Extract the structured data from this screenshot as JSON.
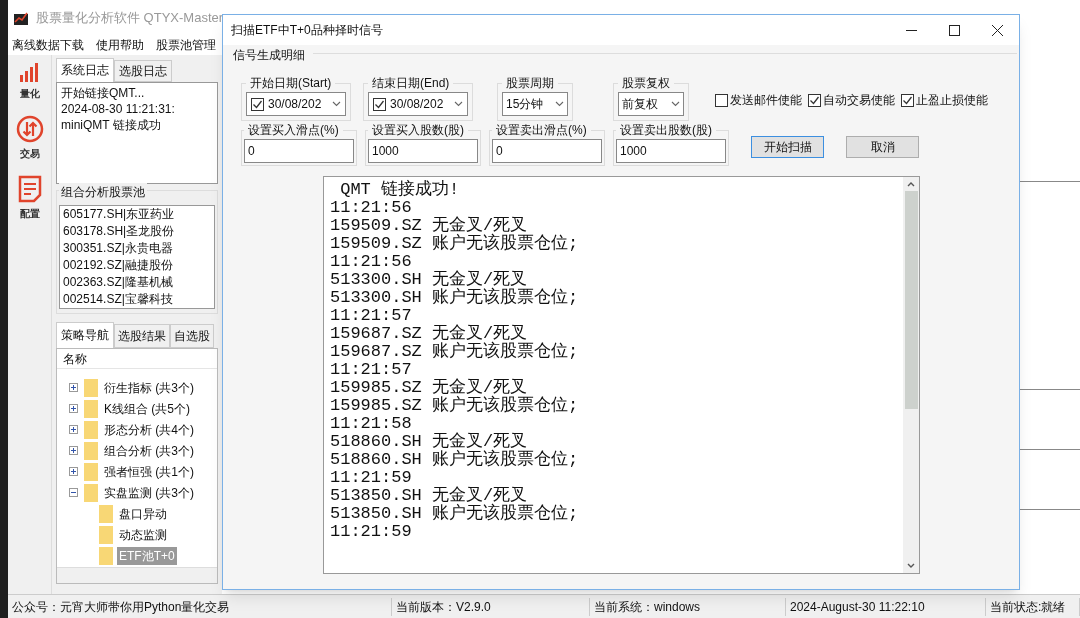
{
  "app": {
    "title": "股票量化分析软件 QTYX-Master",
    "menu": [
      "离线数据下载",
      "使用帮助",
      "股票池管理"
    ]
  },
  "sidebar": [
    {
      "label": "量化",
      "kind": "chart"
    },
    {
      "label": "交易",
      "kind": "trade"
    },
    {
      "label": "配置",
      "kind": "config"
    }
  ],
  "log_tabs": [
    {
      "label": "系统日志",
      "selected": true
    },
    {
      "label": "选股日志",
      "selected": false
    }
  ],
  "log_lines": [
    "开始链接QMT...",
    "2024-08-30 11:21:31:",
    "miniQMT 链接成功"
  ],
  "pool": {
    "title": "组合分析股票池",
    "items": [
      "605177.SH|东亚药业",
      "603178.SH|圣龙股份",
      "300351.SZ|永贵电器",
      "002192.SZ|融捷股份",
      "002363.SZ|隆基机械",
      "002514.SZ|宝馨科技"
    ]
  },
  "nav_tabs": [
    {
      "label": "策略导航",
      "selected": true
    },
    {
      "label": "选股结果",
      "selected": false
    },
    {
      "label": "自选股",
      "selected": false
    }
  ],
  "tree": {
    "column": "名称",
    "items": [
      {
        "label": "衍生指标 (共3个)",
        "expanded": false
      },
      {
        "label": "K线组合 (共5个)",
        "expanded": false
      },
      {
        "label": "形态分析 (共4个)",
        "expanded": false
      },
      {
        "label": "组合分析 (共3个)",
        "expanded": false
      },
      {
        "label": "强者恒强 (共1个)",
        "expanded": false
      },
      {
        "label": "实盘监测 (共3个)",
        "expanded": true,
        "children": [
          {
            "label": "盘口异动",
            "selected": false
          },
          {
            "label": "动态监测",
            "selected": false
          },
          {
            "label": "ETF池T+0",
            "selected": true
          }
        ]
      }
    ]
  },
  "dialog": {
    "title": "扫描ETF中T+0品种择时信号",
    "group_title": "信号生成明细",
    "pickers": [
      {
        "kind": "date",
        "label": "开始日期(Start)",
        "checked": true,
        "value": "30/08/202"
      },
      {
        "kind": "date",
        "label": "结束日期(End)",
        "checked": true,
        "value": "30/08/202"
      },
      {
        "kind": "select",
        "label": "股票周期",
        "value": "15分钟"
      },
      {
        "kind": "select",
        "label": "股票复权",
        "value": "前复权"
      }
    ],
    "options": [
      {
        "label": "发送邮件使能",
        "checked": false
      },
      {
        "label": "自动交易使能",
        "checked": true
      },
      {
        "label": "止盈止损使能",
        "checked": true
      }
    ],
    "inputs": [
      {
        "label": "设置买入滑点(%)",
        "value": "0"
      },
      {
        "label": "设置买入股数(股)",
        "value": "1000"
      },
      {
        "label": "设置卖出滑点(%)",
        "value": "0"
      },
      {
        "label": "设置卖出股数(股)",
        "value": "1000"
      }
    ],
    "buttons": [
      {
        "label": "开始扫描",
        "default": true
      },
      {
        "label": "取消",
        "default": false
      }
    ],
    "log": [
      " QMT 链接成功!",
      "11:21:56",
      "159509.SZ 无金叉/死叉",
      "159509.SZ 账户无该股票仓位;",
      "11:21:56",
      "513300.SH 无金叉/死叉",
      "513300.SH 账户无该股票仓位;",
      "11:21:57",
      "159687.SZ 无金叉/死叉",
      "159687.SZ 账户无该股票仓位;",
      "11:21:57",
      "159985.SZ 无金叉/死叉",
      "159985.SZ 账户无该股票仓位;",
      "11:21:58",
      "518860.SH 无金叉/死叉",
      "518860.SH 账户无该股票仓位;",
      "11:21:59",
      "513850.SH 无金叉/死叉",
      "513850.SH 账户无该股票仓位;",
      "11:21:59"
    ]
  },
  "status_bar": [
    "公众号：元宵大师带你用Python量化交易",
    "当前版本：V2.9.0",
    "当前系统：windows",
    "2024-August-30 11:22:10",
    "当前状态:就绪"
  ]
}
